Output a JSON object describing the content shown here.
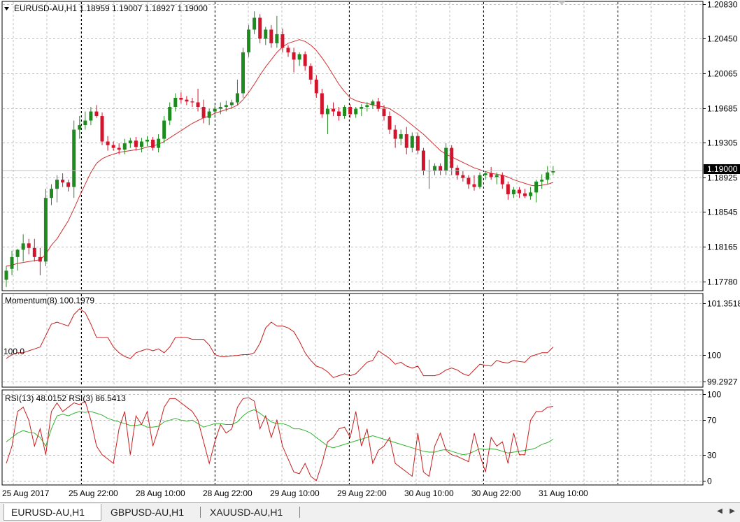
{
  "window": {
    "symbol_header": "EURUSD-AU,H1  1.18959 1.19007 1.18927 1.19000",
    "current_price": "1.19000"
  },
  "colors": {
    "bull": "#1f8b1f",
    "bear": "#d2152d",
    "ma_line": "#d23030",
    "momentum_line": "#c81e1e",
    "rsi_fast": "#c81e1e",
    "rsi_slow": "#2fb62f",
    "grid": "#c0c0c0",
    "price_tag_bg": "#000000"
  },
  "tabs": [
    "EURUSD-AU,H1",
    "GBPUSD-AU,H1",
    "XAUUSD-AU,H1"
  ],
  "chart_data": [
    {
      "type": "candlestick",
      "panel": "price",
      "title": "EURUSD-AU,H1  1.18959 1.19007 1.18927 1.19000",
      "y_ticks": [
        "1.20830",
        "1.20450",
        "1.20065",
        "1.19685",
        "1.19305",
        "1.18925",
        "1.18545",
        "1.18165",
        "1.17780"
      ],
      "y_tick_values": [
        1.2083,
        1.2045,
        1.20065,
        1.19685,
        1.19305,
        1.18925,
        1.18545,
        1.18165,
        1.1778
      ],
      "ylim": [
        1.1768,
        1.2086
      ],
      "x_ticks": [
        "25 Aug 2017",
        "25 Aug 22:00",
        "28 Aug 10:00",
        "28 Aug 22:00",
        "29 Aug 10:00",
        "29 Aug 22:00",
        "30 Aug 10:00",
        "30 Aug 22:00",
        "31 Aug 10:00"
      ],
      "grid": true,
      "candles_ohlc": [
        [
          1.178,
          1.1795,
          1.1772,
          1.179
        ],
        [
          1.1792,
          1.1812,
          1.1785,
          1.1805
        ],
        [
          1.1805,
          1.1814,
          1.179,
          1.1813
        ],
        [
          1.1813,
          1.183,
          1.18,
          1.182
        ],
        [
          1.182,
          1.1825,
          1.1808,
          1.1815
        ],
        [
          1.1815,
          1.1825,
          1.18,
          1.1805
        ],
        [
          1.1805,
          1.1815,
          1.1785,
          1.18
        ],
        [
          1.18,
          1.188,
          1.1795,
          1.187
        ],
        [
          1.187,
          1.1885,
          1.1862,
          1.188
        ],
        [
          1.188,
          1.1895,
          1.1865,
          1.189
        ],
        [
          1.189,
          1.1897,
          1.1882,
          1.1887
        ],
        [
          1.1887,
          1.189,
          1.1877,
          1.1882
        ],
        [
          1.1882,
          1.1955,
          1.187,
          1.1945
        ],
        [
          1.1945,
          1.196,
          1.1935,
          1.195
        ],
        [
          1.195,
          1.1965,
          1.1945,
          1.1955
        ],
        [
          1.1955,
          1.197,
          1.195,
          1.1965
        ],
        [
          1.1965,
          1.1972,
          1.1958,
          1.196
        ],
        [
          1.196,
          1.1964,
          1.1928,
          1.1932
        ],
        [
          1.1932,
          1.1938,
          1.1922,
          1.1928
        ],
        [
          1.1928,
          1.1932,
          1.1922,
          1.1925
        ],
        [
          1.1925,
          1.193,
          1.1918,
          1.1923
        ],
        [
          1.1923,
          1.1935,
          1.1918,
          1.193
        ],
        [
          1.193,
          1.1936,
          1.1925,
          1.1933
        ],
        [
          1.1933,
          1.1937,
          1.1922,
          1.1926
        ],
        [
          1.1926,
          1.1936,
          1.192,
          1.1932
        ],
        [
          1.1932,
          1.1938,
          1.1927,
          1.1934
        ],
        [
          1.1934,
          1.1937,
          1.1922,
          1.1925
        ],
        [
          1.1925,
          1.194,
          1.192,
          1.1935
        ],
        [
          1.1935,
          1.196,
          1.193,
          1.1955
        ],
        [
          1.1955,
          1.1975,
          1.195,
          1.197
        ],
        [
          1.197,
          1.1985,
          1.1965,
          1.198
        ],
        [
          1.198,
          1.1986,
          1.1974,
          1.1978
        ],
        [
          1.1978,
          1.1982,
          1.1972,
          1.1976
        ],
        [
          1.1976,
          1.198,
          1.197,
          1.1975
        ],
        [
          1.1975,
          1.199,
          1.1965,
          1.197
        ],
        [
          1.197,
          1.1978,
          1.1952,
          1.1958
        ],
        [
          1.1958,
          1.1968,
          1.195,
          1.1965
        ],
        [
          1.1965,
          1.1972,
          1.1958,
          1.1968
        ],
        [
          1.1968,
          1.1975,
          1.1962,
          1.197
        ],
        [
          1.197,
          1.1977,
          1.1965,
          1.1972
        ],
        [
          1.1972,
          1.1978,
          1.1968,
          1.1975
        ],
        [
          1.1975,
          1.2,
          1.1972,
          1.1985
        ],
        [
          1.1985,
          1.2035,
          1.198,
          1.203
        ],
        [
          1.203,
          1.206,
          1.2025,
          1.2055
        ],
        [
          1.2055,
          1.2075,
          1.205,
          1.2068
        ],
        [
          1.2068,
          1.2072,
          1.204,
          1.2045
        ],
        [
          1.2045,
          1.2058,
          1.2038,
          1.2055
        ],
        [
          1.2055,
          1.206,
          1.2035,
          1.204
        ],
        [
          1.204,
          1.207,
          1.2035,
          1.205
        ],
        [
          1.205,
          1.2056,
          1.203,
          1.2035
        ],
        [
          1.2035,
          1.2038,
          1.2025,
          1.203
        ],
        [
          1.203,
          1.2035,
          1.2008,
          1.2022
        ],
        [
          1.2022,
          1.203,
          1.2015,
          1.2028
        ],
        [
          1.2028,
          1.2031,
          1.201,
          1.2015
        ],
        [
          1.2015,
          1.2018,
          1.1995,
          1.2
        ],
        [
          1.2,
          1.2005,
          1.198,
          1.1985
        ],
        [
          1.1985,
          1.199,
          1.1958,
          1.1962
        ],
        [
          1.1962,
          1.1972,
          1.194,
          1.1968
        ],
        [
          1.1968,
          1.1975,
          1.196,
          1.1965
        ],
        [
          1.1965,
          1.197,
          1.1955,
          1.196
        ],
        [
          1.196,
          1.1972,
          1.1957,
          1.197
        ],
        [
          1.197,
          1.1973,
          1.1958,
          1.1962
        ],
        [
          1.1962,
          1.197,
          1.1958,
          1.1968
        ],
        [
          1.1968,
          1.1973,
          1.196,
          1.197
        ],
        [
          1.197,
          1.1975,
          1.1965,
          1.1972
        ],
        [
          1.1972,
          1.1978,
          1.1968,
          1.1976
        ],
        [
          1.1976,
          1.198,
          1.1965,
          1.1968
        ],
        [
          1.1968,
          1.1972,
          1.1955,
          1.196
        ],
        [
          1.196,
          1.1965,
          1.194,
          1.1945
        ],
        [
          1.1945,
          1.195,
          1.1925,
          1.1935
        ],
        [
          1.1935,
          1.1945,
          1.1928,
          1.194
        ],
        [
          1.194,
          1.1948,
          1.1918,
          1.1925
        ],
        [
          1.1925,
          1.1942,
          1.192,
          1.1938
        ],
        [
          1.1938,
          1.1942,
          1.1918,
          1.1922
        ],
        [
          1.1922,
          1.1925,
          1.1895,
          1.19
        ],
        [
          1.19,
          1.1912,
          1.188,
          1.19
        ],
        [
          1.19,
          1.1908,
          1.1895,
          1.1905
        ],
        [
          1.1905,
          1.1908,
          1.1895,
          1.19
        ],
        [
          1.19,
          1.193,
          1.1895,
          1.1925
        ],
        [
          1.1925,
          1.1928,
          1.1895,
          1.1903
        ],
        [
          1.1903,
          1.1906,
          1.189,
          1.1895
        ],
        [
          1.1895,
          1.19,
          1.1888,
          1.1892
        ],
        [
          1.1892,
          1.1895,
          1.188,
          1.1885
        ],
        [
          1.1885,
          1.1895,
          1.1878,
          1.1882
        ],
        [
          1.1882,
          1.1898,
          1.188,
          1.1895
        ],
        [
          1.1895,
          1.19,
          1.189,
          1.1897
        ],
        [
          1.1897,
          1.1904,
          1.189,
          1.1893
        ],
        [
          1.1893,
          1.1898,
          1.1885,
          1.1895
        ],
        [
          1.1895,
          1.1898,
          1.188,
          1.1885
        ],
        [
          1.1885,
          1.1888,
          1.1868,
          1.1874
        ],
        [
          1.1874,
          1.1882,
          1.187,
          1.1879
        ],
        [
          1.1879,
          1.1882,
          1.187,
          1.1875
        ],
        [
          1.1875,
          1.188,
          1.187,
          1.1872
        ],
        [
          1.1872,
          1.1882,
          1.1868,
          1.1876
        ],
        [
          1.1876,
          1.189,
          1.1865,
          1.1888
        ],
        [
          1.1888,
          1.1896,
          1.188,
          1.189
        ],
        [
          1.189,
          1.1905,
          1.1885,
          1.1898
        ],
        [
          1.1898,
          1.1905,
          1.1895,
          1.19
        ]
      ],
      "ma_values": [
        1.1795,
        1.1796,
        1.1798,
        1.1799,
        1.18,
        1.1801,
        1.1802,
        1.1808,
        1.1818,
        1.1825,
        1.1835,
        1.1845,
        1.1858,
        1.1872,
        1.1885,
        1.1898,
        1.1908,
        1.1913,
        1.1916,
        1.1918,
        1.192,
        1.1921,
        1.1922,
        1.1923,
        1.1924,
        1.1926,
        1.1927,
        1.1929,
        1.1932,
        1.1936,
        1.194,
        1.1944,
        1.1948,
        1.1952,
        1.1955,
        1.1958,
        1.196,
        1.1963,
        1.1965,
        1.1967,
        1.1969,
        1.1972,
        1.1978,
        1.1986,
        1.1995,
        1.2005,
        1.2014,
        1.2022,
        1.203,
        1.2036,
        1.204,
        1.2042,
        1.2044,
        1.2042,
        1.2038,
        1.2032,
        1.2024,
        1.2015,
        1.2005,
        1.1995,
        1.1987,
        1.198,
        1.1977,
        1.1975,
        1.1974,
        1.1972,
        1.1971,
        1.197,
        1.1968,
        1.1964,
        1.196,
        1.1955,
        1.195,
        1.1945,
        1.194,
        1.1934,
        1.1928,
        1.1922,
        1.1918,
        1.1915,
        1.1912,
        1.1909,
        1.1906,
        1.1903,
        1.1901,
        1.1899,
        1.1897,
        1.1896,
        1.1895,
        1.1893,
        1.189,
        1.1888,
        1.1886,
        1.1884,
        1.1883,
        1.1884,
        1.1885,
        1.1887
      ]
    },
    {
      "type": "line",
      "panel": "momentum",
      "title": "Momentum(8) 100.1979",
      "level_label": "100.0",
      "y_ticks": [
        "101.3518",
        "100",
        "99.2927"
      ],
      "y_tick_values": [
        101.3518,
        100,
        99.2927
      ],
      "ylim": [
        99.15,
        101.6
      ],
      "grid": true,
      "values": [
        99.9,
        100.0,
        100.05,
        100.05,
        100.1,
        100.15,
        100.2,
        100.5,
        100.8,
        100.85,
        100.8,
        100.75,
        101.05,
        101.2,
        101.1,
        100.8,
        100.45,
        100.45,
        100.45,
        100.2,
        100.05,
        99.95,
        99.9,
        100.05,
        100.1,
        100.15,
        100.1,
        100.15,
        100.05,
        100.2,
        100.45,
        100.45,
        100.45,
        100.4,
        100.4,
        100.4,
        100.25,
        100.0,
        99.95,
        99.95,
        99.97,
        99.98,
        100.0,
        100.0,
        100.05,
        100.3,
        100.7,
        100.85,
        100.75,
        100.75,
        100.7,
        100.6,
        100.35,
        100.05,
        99.85,
        99.7,
        99.65,
        99.55,
        99.4,
        99.45,
        99.5,
        99.45,
        99.5,
        99.65,
        99.8,
        99.85,
        100.1,
        100.0,
        99.9,
        99.75,
        99.8,
        99.7,
        99.65,
        99.7,
        99.45,
        99.45,
        99.45,
        99.5,
        99.6,
        99.65,
        99.6,
        99.5,
        99.45,
        99.6,
        99.75,
        99.72,
        99.7,
        99.85,
        99.8,
        99.78,
        99.85,
        99.82,
        99.8,
        99.95,
        100.0,
        100.05,
        100.05,
        100.2
      ]
    },
    {
      "type": "line",
      "panel": "rsi",
      "title": "RSI(13) 48.0152  RSI(3) 86.5413",
      "y_ticks": [
        "100",
        "70",
        "30",
        "0"
      ],
      "y_tick_values": [
        100,
        70,
        30,
        0
      ],
      "ylim": [
        -5,
        105
      ],
      "grid": true,
      "series": [
        {
          "name": "RSI(13)",
          "values": [
            45,
            50,
            55,
            58,
            56,
            55,
            50,
            40,
            60,
            75,
            77,
            75,
            78,
            80,
            79,
            80,
            78,
            76,
            72,
            70,
            68,
            66,
            64,
            64,
            65,
            62,
            62,
            63,
            68,
            70,
            72,
            70,
            69,
            70,
            66,
            62,
            64,
            66,
            66,
            65,
            65,
            68,
            75,
            80,
            82,
            78,
            73,
            68,
            66,
            66,
            64,
            60,
            60,
            58,
            55,
            50,
            45,
            40,
            38,
            40,
            42,
            44,
            46,
            48,
            50,
            52,
            50,
            48,
            46,
            44,
            42,
            40,
            38,
            36,
            34,
            33,
            33,
            35,
            36,
            34,
            32,
            30,
            31,
            34,
            37,
            36,
            37,
            36,
            34,
            32,
            33,
            34,
            35,
            36,
            38,
            42,
            44,
            48
          ]
        },
        {
          "name": "RSI(3)",
          "values": [
            20,
            40,
            80,
            85,
            70,
            40,
            60,
            30,
            80,
            90,
            80,
            85,
            90,
            88,
            92,
            70,
            40,
            30,
            25,
            20,
            60,
            80,
            30,
            75,
            65,
            80,
            40,
            60,
            85,
            95,
            95,
            90,
            85,
            80,
            70,
            45,
            20,
            45,
            65,
            55,
            60,
            85,
            95,
            96,
            92,
            60,
            75,
            50,
            70,
            40,
            25,
            10,
            8,
            20,
            5,
            0,
            20,
            45,
            50,
            60,
            62,
            50,
            80,
            40,
            60,
            20,
            35,
            40,
            50,
            20,
            15,
            10,
            5,
            55,
            10,
            5,
            40,
            55,
            35,
            30,
            28,
            25,
            22,
            55,
            30,
            10,
            50,
            40,
            45,
            20,
            55,
            30,
            30,
            70,
            80,
            80,
            85,
            86
          ]
        }
      ]
    }
  ]
}
